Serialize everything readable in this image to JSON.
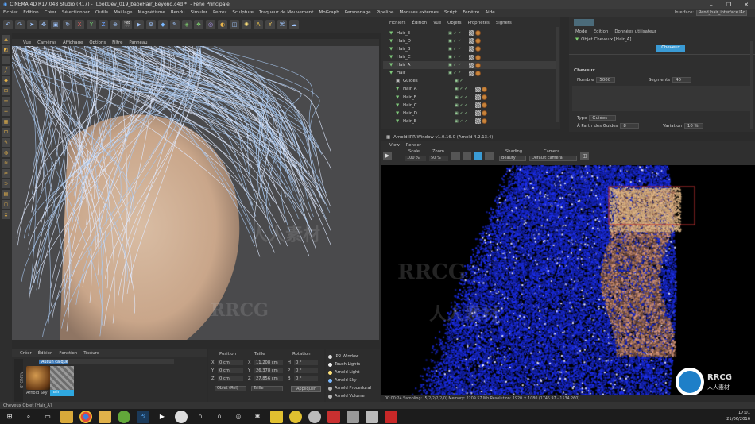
{
  "window": {
    "title": "CINEMA 4D R17.048 Studio (R17) - [LookDev_019_babeHair_Beyond.c4d *] - Fenê Principale",
    "controls": [
      "–",
      "❐",
      "✕"
    ]
  },
  "menubar": {
    "items": [
      "Fichier",
      "Édition",
      "Créer",
      "Sélectionner",
      "Outils",
      "Maillage",
      "Magnétisme",
      "Rendu",
      "Simuler",
      "Perrez",
      "Sculpture",
      "Traqueur de Mouvement",
      "MoGraph",
      "Personnage",
      "Pipeline",
      "Modules externes",
      "Script",
      "Fenêtre",
      "Aide"
    ],
    "interface_label": "Interface:",
    "interface_value": "Rend_hair_interface.l4d"
  },
  "viewport": {
    "menu": [
      "Vue",
      "Caméras",
      "Affichage",
      "Options",
      "Filtre",
      "Panneau"
    ]
  },
  "object_manager": {
    "menu": [
      "Fichiers",
      "Édition",
      "Vue",
      "Objets",
      "Propriétés",
      "Signets"
    ],
    "rows": [
      {
        "name": "Hair_E",
        "flags": "▣ ✓ ✓"
      },
      {
        "name": "Hair_D",
        "flags": "▣ ✓ ✓"
      },
      {
        "name": "Hair_B",
        "flags": "▣ ✓ ✓"
      },
      {
        "name": "Hair_C",
        "flags": "▣ ✓ ✓"
      },
      {
        "name": "Hair_A",
        "flags": "▣ ✓ ✓"
      },
      {
        "name": "Hair",
        "flags": "▣ ✓ ✓"
      },
      {
        "name": "Guides",
        "flags": "▣ ✓"
      },
      {
        "name": "Hair_A",
        "flags": "▣ ✓ ✓"
      },
      {
        "name": "Hair_B",
        "flags": "▣ ✓ ✓"
      },
      {
        "name": "Hair_C",
        "flags": "▣ ✓ ✓"
      },
      {
        "name": "Hair_D",
        "flags": "▣ ✓ ✓"
      },
      {
        "name": "Hair_E",
        "flags": "▣ ✓ ✓"
      }
    ]
  },
  "attributes": {
    "tabs": [
      "Mode",
      "Édition",
      "Données utilisateur"
    ],
    "object_label": "Objet Cheveux [Hair_A]",
    "active_tab": "Cheveux",
    "section": "Cheveux",
    "nombre_label": "Nombre",
    "nombre_value": "5000",
    "segments_label": "Segments",
    "segments_value": "40",
    "type_label": "Type",
    "type_value": "Guides",
    "racines_label": "À Partir des Guides",
    "racines_value": "8",
    "variation_label": "Variation",
    "variation_value": "10 %"
  },
  "render_window": {
    "title": "Arnold IPR Window v1.0.16.0 (Arnold 4.2.13.4)",
    "menu": [
      "View",
      "Render"
    ],
    "scale_label": "Scale",
    "scale_value": "100 %",
    "zoom_label": "Zoom",
    "zoom_value": "50 %",
    "shading_label": "Shading",
    "shading_value": "Beauty",
    "camera_label": "Camera",
    "camera_value": "Default camera",
    "status": "00:00:24  Sampling: [5/2/2/2/2/0]  Memory: 2209.57 Mb  Resolution: 1920 × 1080 (1745.97 - 1534.260)"
  },
  "material": {
    "menu": [
      "Créer",
      "Édition",
      "Fonction",
      "Texture"
    ],
    "filter_label": "Aucun calque",
    "swatches": [
      {
        "label": "Arnold Sky"
      },
      {
        "label": "hair"
      }
    ]
  },
  "coords": {
    "headers": [
      "Position",
      "Taille",
      "Rotation"
    ],
    "rows": [
      {
        "axis": "X",
        "pos": "0 cm",
        "size": "11.208 cm",
        "rot_axis": "H",
        "rot": "0 °"
      },
      {
        "axis": "Y",
        "pos": "0 cm",
        "size": "26.378 cm",
        "rot_axis": "P",
        "rot": "0 °"
      },
      {
        "axis": "Z",
        "pos": "0 cm",
        "size": "27.856 cm",
        "rot_axis": "B",
        "rot": "0 °"
      }
    ],
    "mode_value": "Objet (Rel)",
    "size_mode": "Taille",
    "apply_label": "Appliquer"
  },
  "arnold_menu": [
    "IPR Window",
    "Touch Lights",
    "Arnold Light",
    "Arnold Sky",
    "Arnold Procedural",
    "Arnold Volume"
  ],
  "status_bar": "Cheveux Objet [Hair_A]",
  "taskbar": {
    "time": "17:01",
    "date": "21/06/2016"
  },
  "watermarks": [
    "RRCG",
    "人人素材"
  ],
  "colors": {
    "accent": "#3a9bd5",
    "render_bg": "#000000",
    "hair_blue": "#1f38e0"
  }
}
